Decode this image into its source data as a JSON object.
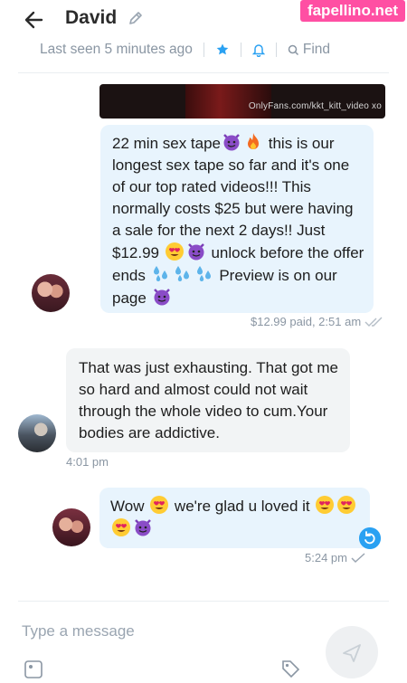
{
  "watermark": "fapellino.net",
  "header": {
    "title": "David",
    "last_seen": "Last seen 5 minutes ago",
    "find_label": "Find"
  },
  "media": {
    "watermark_text": "OnlyFans.com/kkt_kitt_video xo"
  },
  "messages": [
    {
      "direction": "outgoing",
      "segments": [
        {
          "t": "22 min sex tape"
        },
        {
          "e": "devil"
        },
        {
          "e": "fire"
        },
        {
          "t": " this is our longest sex tape so far and it's one of our top rated videos!!! This normally costs $25 but were having a sale for the next 2 days!! Just $12.99 "
        },
        {
          "e": "heart-eyes"
        },
        {
          "e": "devil"
        },
        {
          "t": " unlock before the offer ends "
        },
        {
          "e": "droplets"
        },
        {
          "e": "droplets"
        },
        {
          "e": "droplets"
        },
        {
          "t": " Preview is on our page "
        },
        {
          "e": "devil"
        }
      ],
      "meta": "$12.99 paid, 2:51 am"
    },
    {
      "direction": "incoming",
      "text": "That was just exhausting. That got me so hard and almost could not wait through the whole video to cum.Your bodies are addictive.",
      "meta": "4:01 pm"
    },
    {
      "direction": "outgoing",
      "segments": [
        {
          "t": "Wow "
        },
        {
          "e": "heart-eyes"
        },
        {
          "t": " we're glad u loved it "
        },
        {
          "e": "heart-eyes"
        },
        {
          "e": "heart-eyes"
        },
        {
          "e": "heart-eyes"
        },
        {
          "e": "devil"
        }
      ],
      "meta": "5:24 pm"
    }
  ],
  "composer": {
    "placeholder": "Type a message"
  },
  "colors": {
    "accent": "#2aa1f2",
    "out_bubble": "#e8f4fd",
    "in_bubble": "#f2f4f5",
    "muted": "#8a96a3"
  }
}
